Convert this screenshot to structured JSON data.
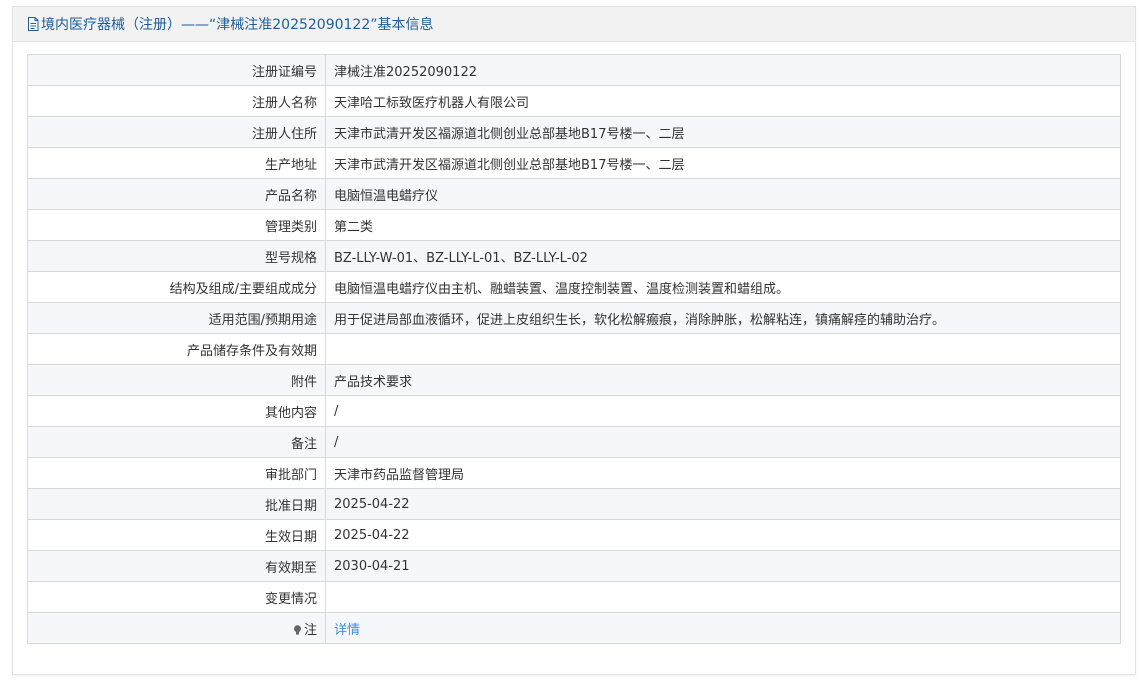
{
  "header": {
    "icon": "document-icon",
    "title": "境内医疗器械（注册）——“津械注准20252090122”基本信息"
  },
  "rows": [
    {
      "label": "注册证编号",
      "value": "津械注准20252090122"
    },
    {
      "label": "注册人名称",
      "value": "天津哈工标致医疗机器人有限公司"
    },
    {
      "label": "注册人住所",
      "value": "天津市武清开发区福源道北侧创业总部基地B17号楼一、二层"
    },
    {
      "label": "生产地址",
      "value": "天津市武清开发区福源道北侧创业总部基地B17号楼一、二层"
    },
    {
      "label": "产品名称",
      "value": "电脑恒温电蜡疗仪"
    },
    {
      "label": "管理类别",
      "value": "第二类"
    },
    {
      "label": "型号规格",
      "value": "BZ-LLY-W-01、BZ-LLY-L-01、BZ-LLY-L-02"
    },
    {
      "label": "结构及组成/主要组成成分",
      "value": "电脑恒温电蜡疗仪由主机、融蜡装置、温度控制装置、温度检测装置和蜡组成。"
    },
    {
      "label": "适用范围/预期用途",
      "value": "用于促进局部血液循环，促进上皮组织生长，软化松解瘢痕，消除肿胀，松解粘连，镇痛解痉的辅助治疗。"
    },
    {
      "label": "产品储存条件及有效期",
      "value": ""
    },
    {
      "label": "附件",
      "value": "产品技术要求"
    },
    {
      "label": "其他内容",
      "value": "/"
    },
    {
      "label": "备注",
      "value": "/"
    },
    {
      "label": "审批部门",
      "value": "天津市药品监督管理局"
    },
    {
      "label": "批准日期",
      "value": "2025-04-22"
    },
    {
      "label": "生效日期",
      "value": "2025-04-22"
    },
    {
      "label": "有效期至",
      "value": "2030-04-21"
    },
    {
      "label": "变更情况",
      "value": ""
    }
  ],
  "note_row": {
    "icon": "lightbulb-icon",
    "label": "注",
    "link": "详情"
  },
  "colors": {
    "title": "#1f5d9c",
    "link": "#3a8ee0",
    "header_bg": "#f2f2f2",
    "alt_row_bg": "#f6f7fb",
    "border": "#d9d9d9"
  }
}
